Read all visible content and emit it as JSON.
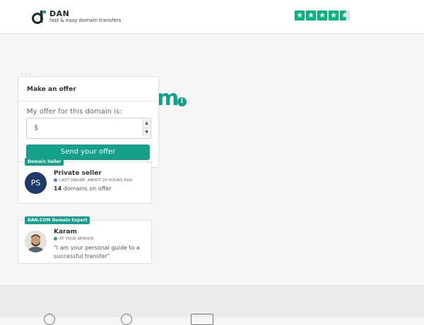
{
  "brand": {
    "name": "DAN",
    "tagline": "fast & easy domain transfers",
    "accent": "#15a08b"
  },
  "trustpilot": {
    "rating_stars": 4.5,
    "star_color": "#00b67a"
  },
  "background": {
    "title_fragment": "m"
  },
  "offer": {
    "title": "Make an offer",
    "label": "My offer for this domain is:",
    "currency": "$",
    "placeholder": "",
    "button": "Send your offer"
  },
  "seller": {
    "badge": "Domain Seller",
    "initials": "PS",
    "name": "Private seller",
    "status": "LAST ONLINE: ABOUT 20 HOURS AGO",
    "status_color": "#5b7fd6",
    "domains_count": "14",
    "domains_text": " domains on offer"
  },
  "expert": {
    "badge": "DAN.COM Domain Expert",
    "name": "Karam",
    "status": "AT YOUR SERVICE",
    "status_color": "#2ab34a",
    "quote": "\"I am your personal guide to a successful transfer\""
  }
}
